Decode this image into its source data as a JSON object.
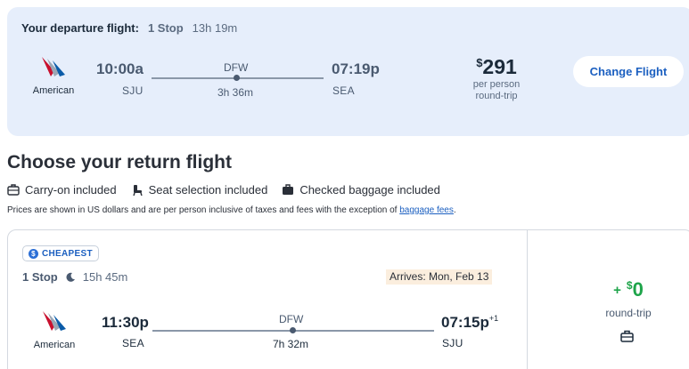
{
  "departure": {
    "label": "Your departure flight:",
    "stops": "1 Stop",
    "duration": "13h 19m",
    "airline": "American",
    "depart_time": "10:00a",
    "depart_code": "SJU",
    "stop_code": "DFW",
    "leg_duration": "3h 36m",
    "arrive_time": "07:19p",
    "arrive_code": "SEA",
    "price_currency": "$",
    "price_value": "291",
    "price_per": "per person",
    "price_rt": "round-trip",
    "change_label": "Change Flight"
  },
  "section": {
    "title": "Choose your return flight",
    "amenities": [
      "Carry-on included",
      "Seat selection included",
      "Checked baggage included"
    ],
    "disclaimer": "Prices are shown in US dollars and are per person inclusive of taxes and fees with the exception of",
    "disclaimer_link": "baggage fees",
    "disclaimer_end": "."
  },
  "return_flight": {
    "badge": "CHEAPEST",
    "stops": "1 Stop",
    "duration": "15h 45m",
    "arrives": "Arrives: Mon, Feb 13",
    "airline": "American",
    "depart_time": "11:30p",
    "depart_code": "SEA",
    "stop_code": "DFW",
    "leg_duration": "7h 32m",
    "arrive_time": "07:15p",
    "arrive_day_offset": "+1",
    "arrive_code": "SJU",
    "price_sign": "+",
    "price_currency": "$",
    "price_value": "0",
    "price_rt": "round-trip"
  },
  "icons": {
    "airline_logo": "american-airlines-logo",
    "carry_on": "carry-on-bag-icon",
    "seat": "seat-icon",
    "checked_bag": "checked-bag-icon",
    "moon": "moon-icon",
    "coin": "dollar-coin-icon"
  },
  "colors": {
    "accent": "#1b5fc0",
    "card_bg": "#e6eefb",
    "price_green": "#1ea44a",
    "arrives_bg": "#fbeede"
  }
}
